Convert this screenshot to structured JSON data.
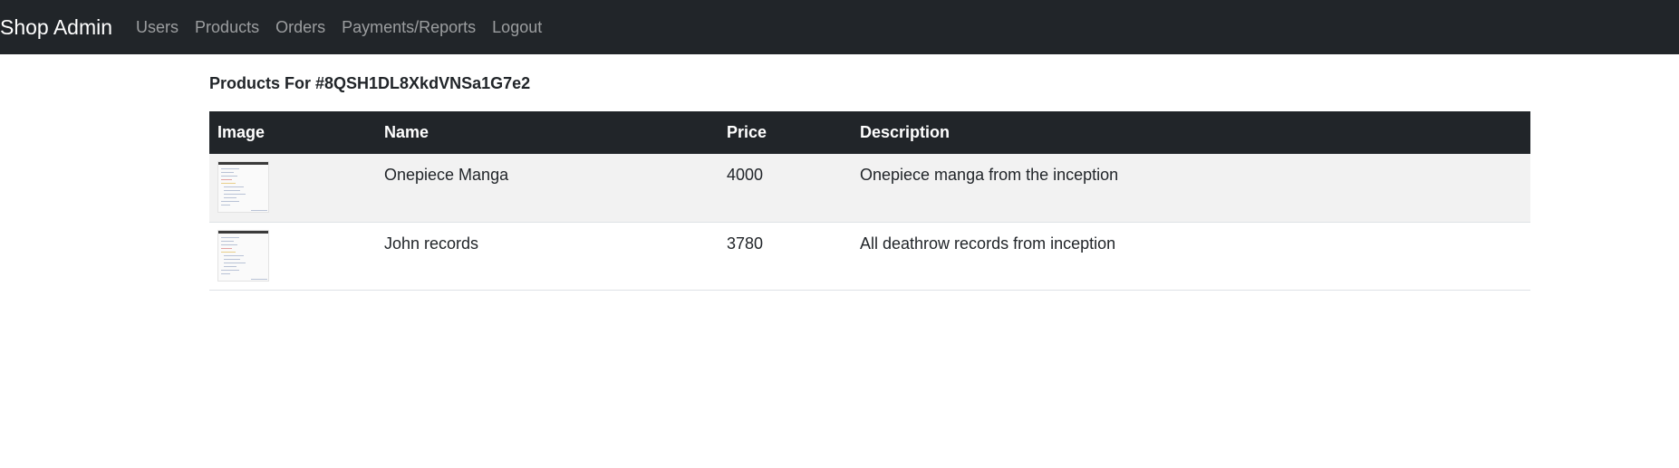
{
  "navbar": {
    "brand": "Shop Admin",
    "links": [
      "Users",
      "Products",
      "Orders",
      "Payments/Reports",
      "Logout"
    ]
  },
  "page": {
    "heading": "Products For #8QSH1DL8XkdVNSa1G7e2"
  },
  "table": {
    "columns": [
      "Image",
      "Name",
      "Price",
      "Description"
    ],
    "rows": [
      {
        "image": "product-thumbnail",
        "name": "Onepiece Manga",
        "price": "4000",
        "description": "Onepiece manga from the inception"
      },
      {
        "image": "product-thumbnail",
        "name": "John records",
        "price": "3780",
        "description": "All deathrow records from inception"
      }
    ]
  },
  "colors": {
    "navbar_bg": "#212529",
    "stripe_bg": "#f2f2f2"
  }
}
